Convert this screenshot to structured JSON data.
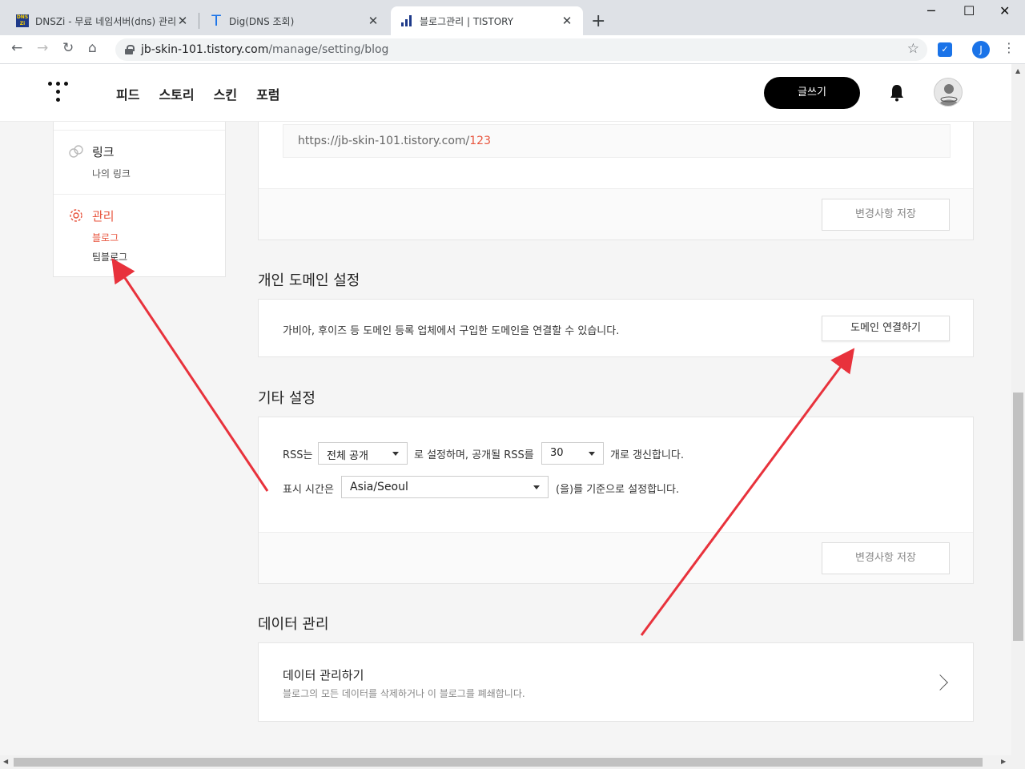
{
  "browser": {
    "tabs": [
      {
        "title": "DNSZi - 무료 네임서버(dns) 관리",
        "favicon": "dnszi-favicon",
        "active": false
      },
      {
        "title": "Dig(DNS 조회)",
        "favicon": "t-favicon",
        "active": false
      },
      {
        "title": "블로그관리 | TISTORY",
        "favicon": "tistory-favicon",
        "active": true
      }
    ],
    "url_host": "jb-skin-101.tistory.com",
    "url_path": "/manage/setting/blog",
    "profile_initial": "J"
  },
  "header": {
    "nav": [
      "피드",
      "스토리",
      "스킨",
      "포럼"
    ],
    "write_label": "글쓰기"
  },
  "sidebar": {
    "link_title": "링크",
    "link_sub": "나의 링크",
    "manage_title": "관리",
    "manage_sub_active": "블로그",
    "manage_sub_team": "팀블로그"
  },
  "address_section": {
    "url_prefix": "https://jb-skin-101.tistory.com/",
    "url_suffix": "123",
    "save_label": "변경사항 저장"
  },
  "domain_section": {
    "title": "개인 도메인 설정",
    "description": "가비아, 후이즈 등 도메인 등록 업체에서 구입한 도메인을 연결할 수 있습니다.",
    "connect_label": "도메인 연결하기"
  },
  "etc_section": {
    "title": "기타 설정",
    "rss_prefix": "RSS는",
    "rss_visibility": "전체 공개",
    "rss_middle": "로 설정하며, 공개될 RSS를",
    "rss_count": "30",
    "rss_suffix": "개로 갱신합니다.",
    "tz_prefix": "표시 시간은",
    "timezone": "Asia/Seoul",
    "tz_suffix": "(을)를 기준으로 설정합니다.",
    "save_label": "변경사항 저장"
  },
  "data_section": {
    "title": "데이터 관리",
    "link_title": "데이터 관리하기",
    "link_desc": "블로그의 모든 데이터를 삭제하거나 이 블로그를 폐쇄합니다."
  },
  "colors": {
    "accent": "#e8553e",
    "annotation_arrow": "#e8323c",
    "dark_button": "#000000"
  }
}
